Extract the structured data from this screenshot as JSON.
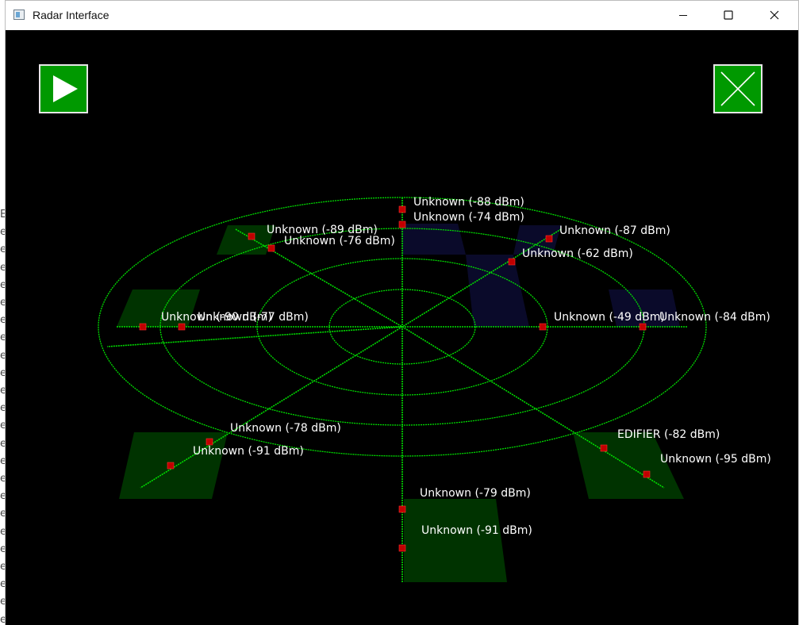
{
  "window": {
    "title": "Radar Interface",
    "controls": [
      "minimize",
      "maximize",
      "close"
    ]
  },
  "background_window": {
    "text_fragments": [
      "E",
      "e",
      "e",
      "e",
      "e",
      "e",
      "e",
      "e",
      "e",
      "e",
      "e",
      "e",
      "e",
      "e",
      "e",
      "e",
      "e",
      "e",
      "e",
      "e",
      "e",
      "e",
      "e",
      "e"
    ]
  },
  "toolbar": {
    "play_icon": "play-icon",
    "close_icon": "close-x-icon",
    "accent": "#009900"
  },
  "radar": {
    "grid_color": "#00dd00",
    "marker_color": "#c00000",
    "label_color": "#ffffff",
    "devices": [
      {
        "label": "Unknown  (-88 dBm)"
      },
      {
        "label": "Unknown  (-74 dBm)"
      },
      {
        "label": "Unknown  (-87 dBm)"
      },
      {
        "label": "Unknown  (-62 dBm)"
      },
      {
        "label": "Unknown  (-89 dBm)"
      },
      {
        "label": "Unknown  (-76 dBm)"
      },
      {
        "label": "Unknown  (-90 dBm)"
      },
      {
        "label": "Unknown  (-77 dBm)"
      },
      {
        "label": "Unknown  (-49 dBm)"
      },
      {
        "label": "Unknown  (-84 dBm)"
      },
      {
        "label": "Unknown  (-78 dBm)"
      },
      {
        "label": "Unknown  (-91 dBm)"
      },
      {
        "label": "EDIFIER  (-82 dBm)"
      },
      {
        "label": "Unknown  (-95 dBm)"
      },
      {
        "label": "Unknown  (-79 dBm)"
      },
      {
        "label": "Unknown  (-91 dBm)"
      }
    ]
  }
}
